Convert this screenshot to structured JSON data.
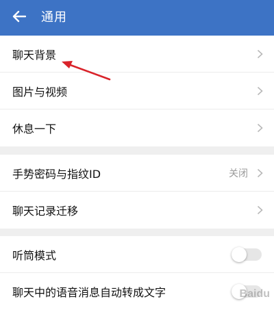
{
  "header": {
    "back_icon": "back-arrow-icon",
    "title": "通用",
    "background": "#3d73c5"
  },
  "group1": {
    "items": [
      {
        "label": "聊天背景"
      },
      {
        "label": "图片与视频"
      },
      {
        "label": "休息一下"
      }
    ]
  },
  "group2": {
    "items": [
      {
        "label": "手势密码与指纹ID",
        "value": "关闭"
      },
      {
        "label": "聊天记录迁移"
      }
    ]
  },
  "group3": {
    "items": [
      {
        "label": "听筒模式",
        "toggle_on": false
      },
      {
        "label": "聊天中的语音消息自动转成文字",
        "toggle_on": false
      }
    ]
  },
  "annotation": {
    "color": "#d9232a"
  },
  "watermark": "Baidu"
}
